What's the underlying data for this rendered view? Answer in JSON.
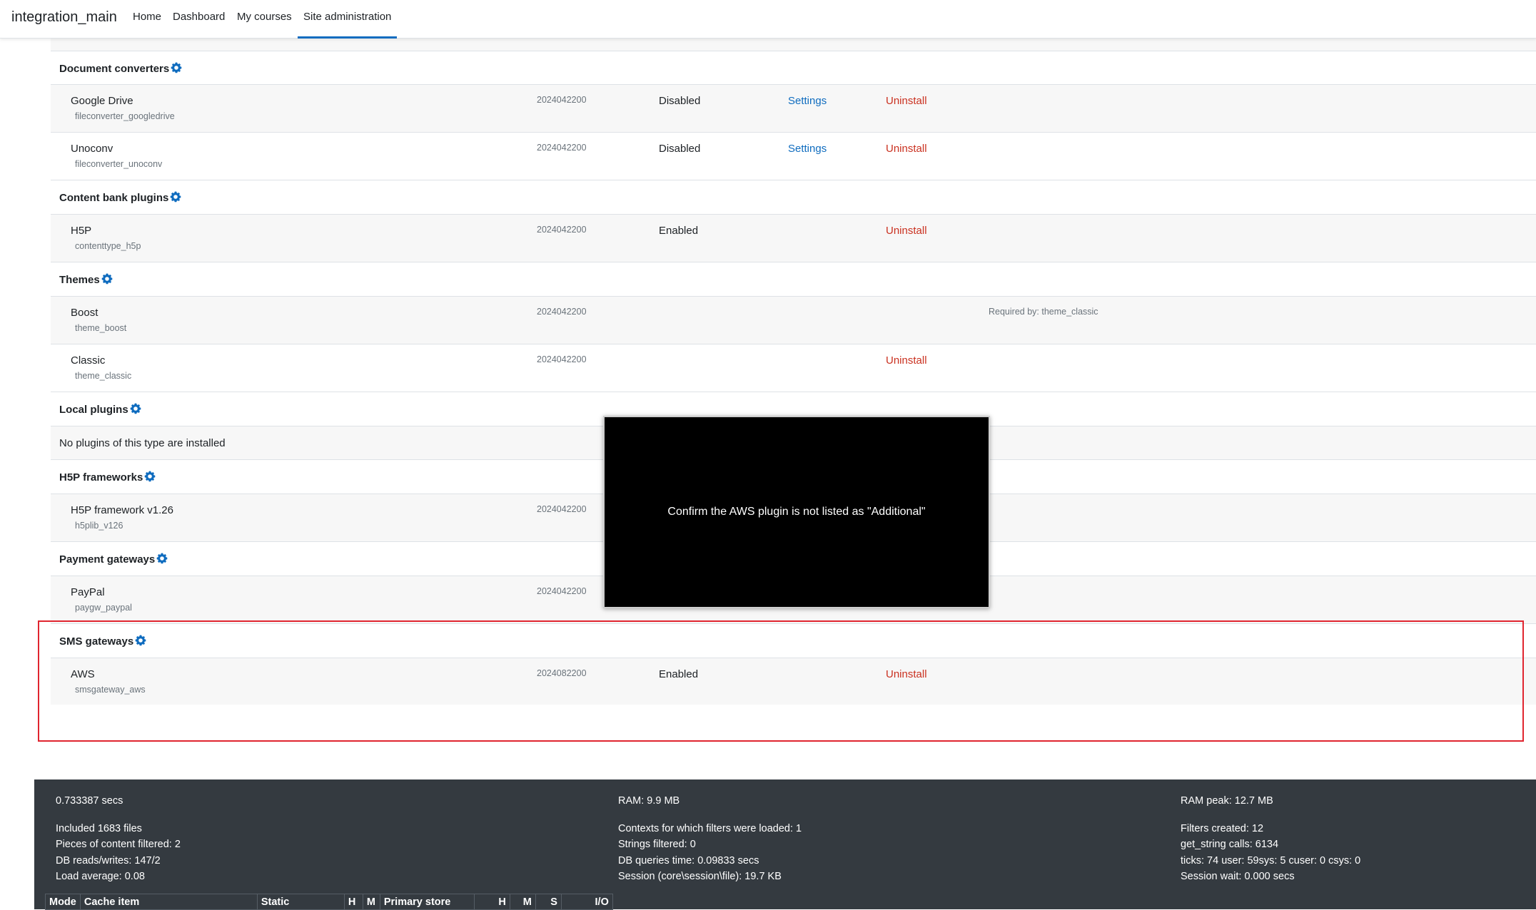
{
  "nav": {
    "brand": "integration_main",
    "links": [
      "Home",
      "Dashboard",
      "My courses",
      "Site administration"
    ]
  },
  "sections": {
    "docconv": {
      "title": "Document converters",
      "plugins": [
        {
          "name": "Google Drive",
          "component": "fileconverter_googledrive",
          "version": "2024042200",
          "status": "Disabled",
          "settings": "Settings",
          "uninstall": "Uninstall"
        },
        {
          "name": "Unoconv",
          "component": "fileconverter_unoconv",
          "version": "2024042200",
          "status": "Disabled",
          "settings": "Settings",
          "uninstall": "Uninstall"
        }
      ]
    },
    "contentbank": {
      "title": "Content bank plugins",
      "plugins": [
        {
          "name": "H5P",
          "component": "contenttype_h5p",
          "version": "2024042200",
          "status": "Enabled",
          "uninstall": "Uninstall"
        }
      ]
    },
    "themes": {
      "title": "Themes",
      "plugins": [
        {
          "name": "Boost",
          "component": "theme_boost",
          "version": "2024042200",
          "notes": "Required by: theme_classic"
        },
        {
          "name": "Classic",
          "component": "theme_classic",
          "version": "2024042200",
          "uninstall": "Uninstall"
        }
      ]
    },
    "local": {
      "title": "Local plugins",
      "empty": "No plugins of this type are installed"
    },
    "h5p": {
      "title": "H5P frameworks",
      "plugins": [
        {
          "name": "H5P framework v1.26",
          "component": "h5plib_v126",
          "version": "2024042200"
        }
      ]
    },
    "payment": {
      "title": "Payment gateways",
      "plugins": [
        {
          "name": "PayPal",
          "component": "paygw_paypal",
          "version": "2024042200"
        }
      ]
    },
    "sms": {
      "title": "SMS gateways",
      "plugins": [
        {
          "name": "AWS",
          "component": "smsgateway_aws",
          "version": "2024082200",
          "status": "Enabled",
          "uninstall": "Uninstall"
        }
      ]
    }
  },
  "overlay": {
    "text": "Confirm the AWS plugin is not listed as \"Additional\""
  },
  "footer": {
    "col1": {
      "time": "0.733387 secs",
      "files": "Included 1683 files",
      "filtered": "Pieces of content filtered: 2",
      "db": "DB reads/writes: 147/2",
      "load": "Load average: 0.08"
    },
    "col2": {
      "ram": "RAM: 9.9 MB",
      "contexts": "Contexts for which filters were loaded: 1",
      "strings": "Strings filtered: 0",
      "dbtime": "DB queries time: 0.09833 secs",
      "session": "Session (core\\session\\file): 19.7 KB"
    },
    "col3": {
      "rampeak": "RAM peak: 12.7 MB",
      "filters": "Filters created: 12",
      "getstring": "get_string calls: 6134",
      "ticks": "ticks: 74 user: 59sys: 5 cuser: 0 csys: 0",
      "sessionwait": "Session wait: 0.000 secs"
    },
    "cache_headers": [
      "Mode",
      "Cache item",
      "Static",
      "H",
      "M",
      "Primary store",
      "H",
      "M",
      "S",
      "I/O"
    ]
  },
  "colors": {
    "link": "#0f6cbf",
    "uninstall": "#ca3120",
    "highlight": "#e0252f",
    "footer_bg": "#343a40"
  },
  "icons": [
    "gear-icon"
  ]
}
